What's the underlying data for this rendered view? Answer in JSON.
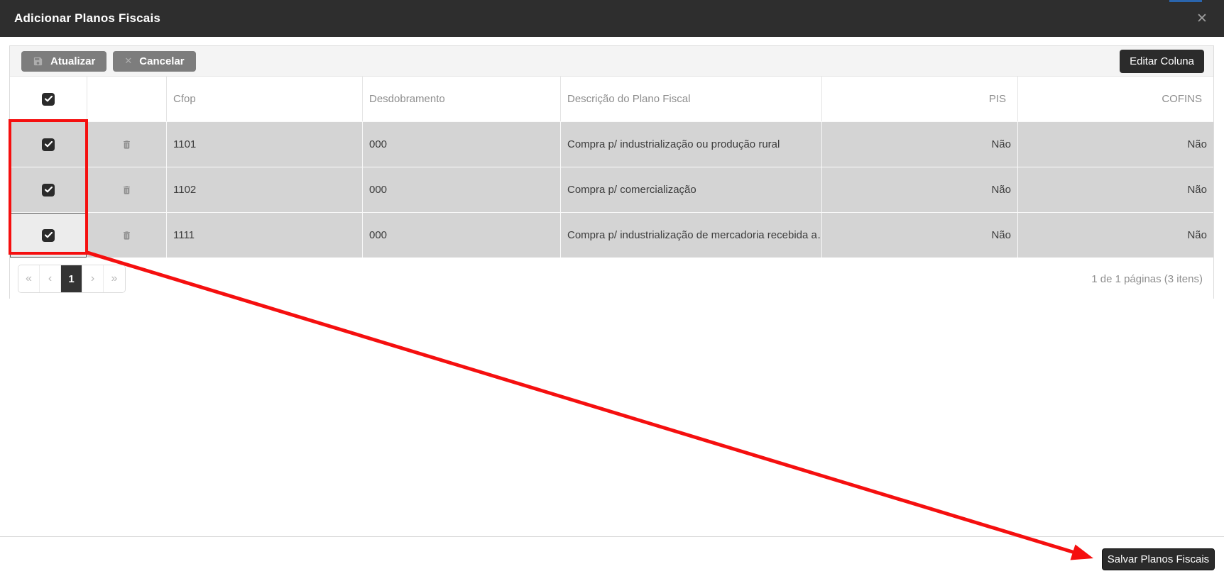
{
  "modal": {
    "title": "Adicionar Planos Fiscais",
    "close_glyph": "✕"
  },
  "toolbar": {
    "atualizar_label": "Atualizar",
    "cancelar_label": "Cancelar",
    "cancelar_glyph": "✕",
    "editar_coluna_label": "Editar Coluna"
  },
  "table": {
    "headers": {
      "cfop": "Cfop",
      "desdobramento": "Desdobramento",
      "descricao": "Descrição do Plano Fiscal",
      "pis": "PIS",
      "cofins": "COFINS"
    },
    "all_selected": true,
    "rows": [
      {
        "selected": true,
        "cfop": "1101",
        "desdobramento": "000",
        "descricao": "Compra p/ industrialização ou produção rural",
        "pis": "Não",
        "cofins": "Não"
      },
      {
        "selected": true,
        "cfop": "1102",
        "desdobramento": "000",
        "descricao": "Compra p/ comercialização",
        "pis": "Não",
        "cofins": "Não"
      },
      {
        "selected": true,
        "cfop": "1111",
        "desdobramento": "000",
        "descricao": "Compra p/ industrialização de mercadoria recebida a…",
        "pis": "Não",
        "cofins": "Não"
      }
    ]
  },
  "pagination": {
    "first_glyph": "«",
    "prev_glyph": "‹",
    "current_page": "1",
    "next_glyph": "›",
    "last_glyph": "»",
    "info": "1 de 1 páginas (3 itens)"
  },
  "footer": {
    "save_label": "Salvar Planos Fiscais"
  },
  "annotation": {
    "color": "#f50f0f",
    "highlighted_region": "selected-row-checkboxes",
    "arrow_target": "salvar-planos-fiscais-button"
  },
  "colors": {
    "titlebar_bg": "#2e2e2e",
    "dark_button_bg": "#2b2b2b",
    "gray_button_bg": "#7d7d7d",
    "toolbar_bg": "#f4f4f4",
    "row_bg": "#d4d4d4"
  }
}
